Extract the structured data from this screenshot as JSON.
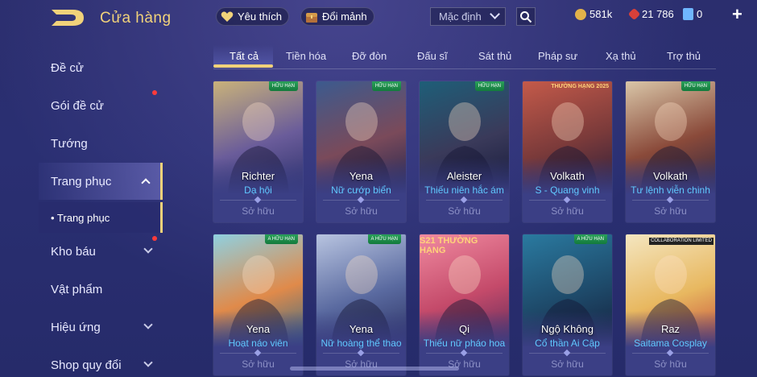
{
  "header": {
    "title": "Cửa hàng",
    "wishlist_label": "Yêu thích",
    "exchange_label": "Đổi mảnh",
    "sort_value": "Mặc định",
    "currencies": [
      {
        "name": "gold-coin-icon",
        "value": "581k",
        "color": "#e2b24a"
      },
      {
        "name": "ruby-icon",
        "value": "21 786",
        "color": "#d8403a"
      },
      {
        "name": "voucher-icon",
        "value": "0",
        "color": "#6fb6ff"
      }
    ]
  },
  "sidebar": {
    "items": [
      {
        "label": "Đề cử"
      },
      {
        "label": "Gói đề cử"
      },
      {
        "label": "Tướng"
      },
      {
        "label": "Trang phục"
      },
      {
        "label": "• Trang phục"
      },
      {
        "label": "Kho báu"
      },
      {
        "label": "Vật phẩm"
      },
      {
        "label": "Hiệu ứng"
      },
      {
        "label": "Shop quy đổi"
      }
    ]
  },
  "tabs": [
    "Tất cả",
    "Tiền hóa",
    "Đỡ đòn",
    "Đấu sĩ",
    "Sát thủ",
    "Pháp sư",
    "Xạ thủ",
    "Trợ thủ"
  ],
  "cards": [
    {
      "hero": "Richter",
      "skin": "Dạ hội",
      "status": "Sở hữu",
      "tag": "HỮU HẠN",
      "art": [
        "#c9b27a",
        "#6a5c9a",
        "#2b2f6a"
      ]
    },
    {
      "hero": "Yena",
      "skin": "Nữ cướp biển",
      "status": "Sở hữu",
      "tag": "HỮU HẠN",
      "art": [
        "#3c5a8e",
        "#7a4a5a",
        "#1e2450"
      ]
    },
    {
      "hero": "Aleister",
      "skin": "Thiếu niên hắc ám",
      "status": "Sở hữu",
      "tag": "HỮU HẠN",
      "art": [
        "#1e5e78",
        "#3a3a5a",
        "#14183a"
      ]
    },
    {
      "hero": "Volkath",
      "skin": "S - Quang vinh",
      "status": "Sở hữu",
      "tag": "THƯỜNG HẠNG 2025",
      "art": [
        "#c45a4a",
        "#7a3a3a",
        "#2a1e3a"
      ]
    },
    {
      "hero": "Volkath",
      "skin": "Tư lệnh viễn chinh",
      "status": "Sở hữu",
      "tag": "HỮU HẠN",
      "art": [
        "#d9c6a8",
        "#8a4a3a",
        "#2a2440"
      ]
    },
    {
      "hero": "Yena",
      "skin": "Hoạt náo viên",
      "status": "Sở hữu",
      "tag": "A HỮU HẠN",
      "art": [
        "#8fd0e0",
        "#e08a4a",
        "#2f6a8a"
      ]
    },
    {
      "hero": "Yena",
      "skin": "Nữ hoàng thể thao",
      "status": "Sở hữu",
      "tag": "A HỮU HẠN",
      "art": [
        "#b8c4e0",
        "#5a6aa0",
        "#2a3060"
      ]
    },
    {
      "hero": "Qi",
      "skin": "Thiếu nữ pháo hoa",
      "status": "Sở hữu",
      "tag": "S21 THƯỜNG HẠNG",
      "art": [
        "#f08aa0",
        "#c44a6a",
        "#5a2a5a"
      ]
    },
    {
      "hero": "Ngộ Không",
      "skin": "Cổ thần Ai Cập",
      "status": "Sở hữu",
      "tag": "A HỮU HẠN",
      "art": [
        "#2a7aa0",
        "#1e4a6a",
        "#141e3a"
      ]
    },
    {
      "hero": "Raz",
      "skin": "Saitama Cosplay",
      "status": "Sở hữu",
      "tag": "COLLABORATION LIMITED",
      "art": [
        "#f4e6c0",
        "#e8b860",
        "#c44a3a"
      ]
    }
  ]
}
